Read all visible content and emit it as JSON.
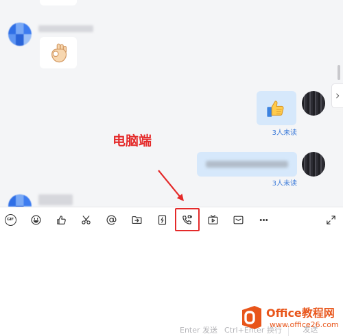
{
  "annotation": {
    "label": "电脑端"
  },
  "messages": [
    {
      "sticker": "ok-hand-sticker"
    },
    {
      "sticker": "thumbs-up-sticker",
      "read_status": "3人未读"
    },
    {
      "read_status": "3人未读"
    }
  ],
  "toolbar": {
    "gif_label": "GIF",
    "icons": [
      "gif-icon",
      "emoji-icon",
      "thumbs-up-icon",
      "scissors-icon",
      "at-mention-icon",
      "folder-send-icon",
      "flash-doc-icon",
      "phone-call-icon",
      "video-play-icon",
      "mail-icon",
      "more-icon",
      "expand-icon"
    ]
  },
  "input": {
    "send_hint": "Enter 发送",
    "newline_hint": "Ctrl+Enter 换行",
    "send_label": "发送"
  },
  "watermark": {
    "brand": "Office教程网",
    "url": "www.office26.com"
  },
  "colors": {
    "annotation_red": "#e42a2a",
    "bubble_blue": "#d6e8fb",
    "read_status_blue": "#3b7ad9",
    "chat_background": "#f4f5f7",
    "watermark_orange": "#e8551a"
  }
}
